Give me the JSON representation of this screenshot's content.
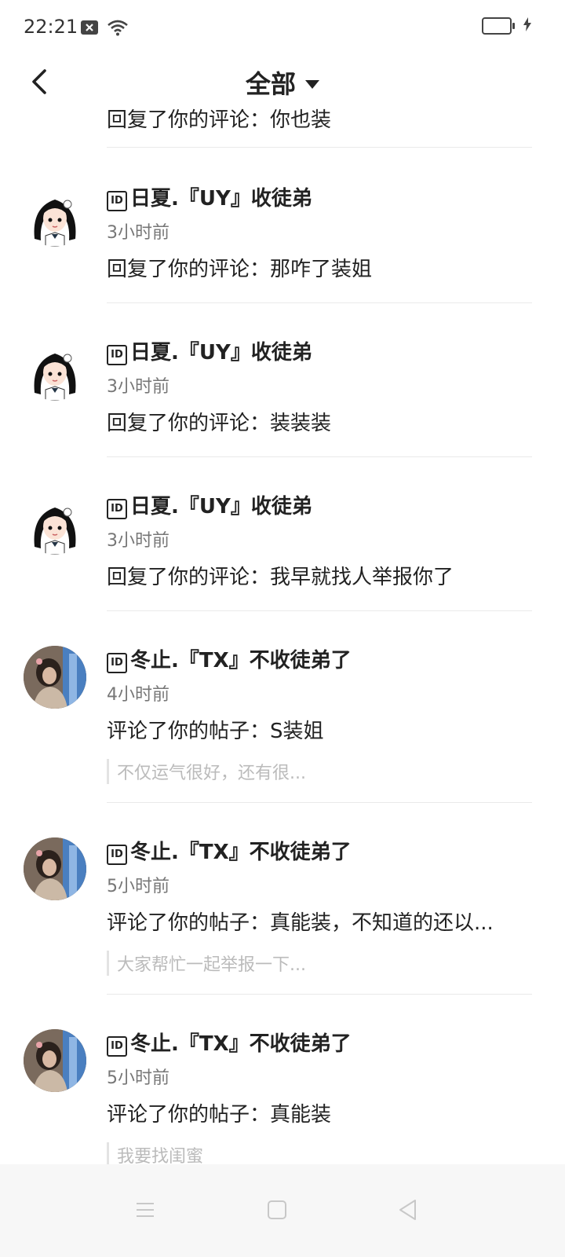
{
  "status_bar": {
    "time": "22:21",
    "icons": [
      "notification-close-icon",
      "wifi-icon",
      "battery-icon",
      "charging-icon"
    ]
  },
  "header": {
    "title": "全部",
    "back_icon": "chevron-left-icon",
    "dropdown_icon": "caret-down-icon"
  },
  "partial_item": {
    "content": "回复了你的评论：你也装"
  },
  "notifications": [
    {
      "avatar": "cartoon-girl-avatar",
      "badge": "ID",
      "name": "日夏.『UY』收徒弟",
      "time": "3小时前",
      "content": "回复了你的评论：那咋了装姐"
    },
    {
      "avatar": "cartoon-girl-avatar",
      "badge": "ID",
      "name": "日夏.『UY』收徒弟",
      "time": "3小时前",
      "content": "回复了你的评论：装装装"
    },
    {
      "avatar": "cartoon-girl-avatar",
      "badge": "ID",
      "name": "日夏.『UY』收徒弟",
      "time": "3小时前",
      "content": "回复了你的评论：我早就找人举报你了"
    },
    {
      "avatar": "photo-avatar",
      "badge": "ID",
      "name": "冬止.『TX』不收徒弟了",
      "time": "4小时前",
      "content": "评论了你的帖子：S装姐",
      "quote": "不仅运气很好，还有很..."
    },
    {
      "avatar": "photo-avatar",
      "badge": "ID",
      "name": "冬止.『TX』不收徒弟了",
      "time": "5小时前",
      "content": "评论了你的帖子：真能装，不知道的还以...",
      "quote": "大家帮忙一起举报一下..."
    },
    {
      "avatar": "photo-avatar",
      "badge": "ID",
      "name": "冬止.『TX』不收徒弟了",
      "time": "5小时前",
      "content": "评论了你的帖子：真能装",
      "quote": "我要找闺蜜"
    }
  ],
  "nav_bar": {
    "icons": [
      "menu-icon",
      "home-square-icon",
      "back-triangle-icon"
    ]
  },
  "colors": {
    "background": "#ffffff",
    "text": "#222222",
    "secondary_text": "#777777",
    "quote_text": "#bbbbbb",
    "nav_bar": "#f7f7f7"
  }
}
